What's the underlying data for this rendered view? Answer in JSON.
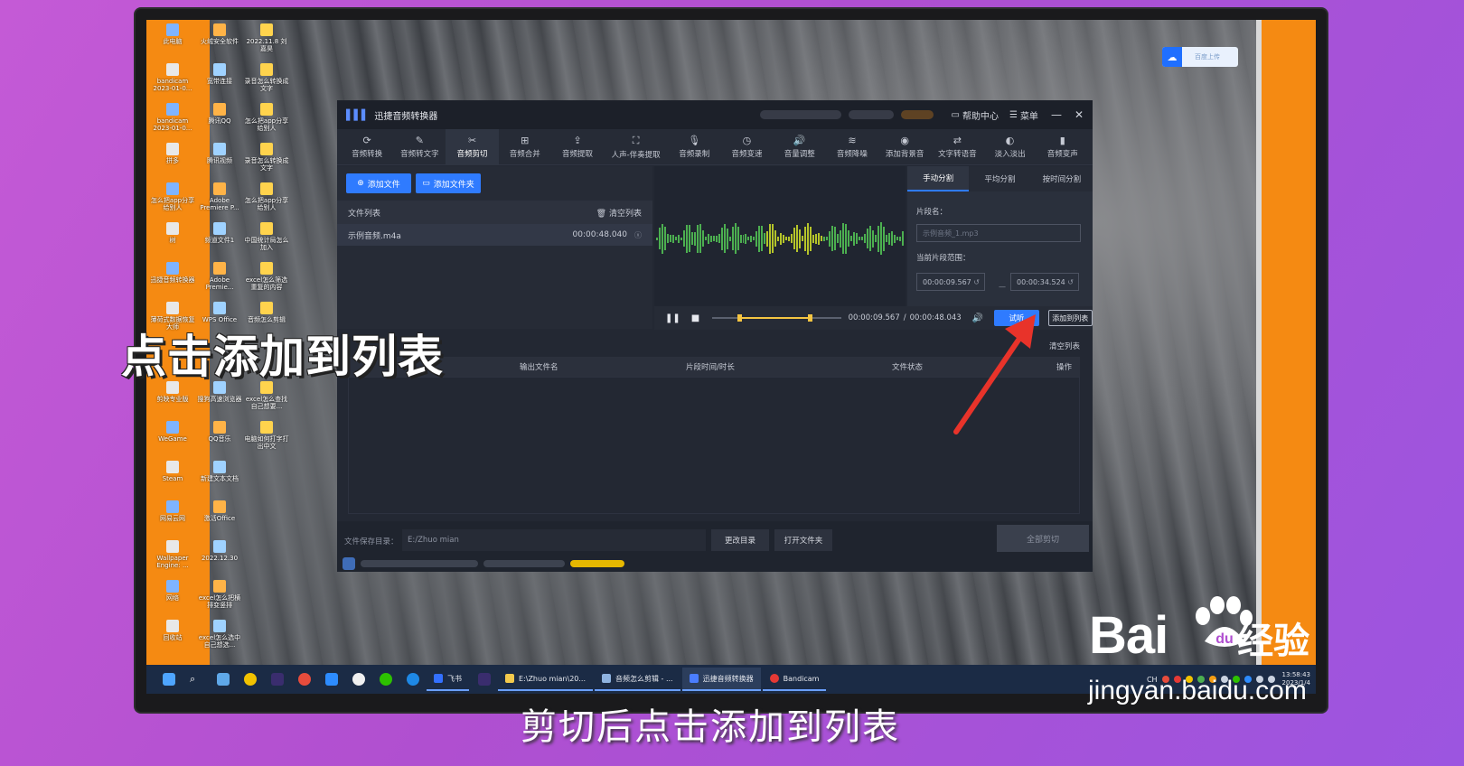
{
  "desktop": {
    "icons": [
      "此电脑",
      "火绒安全软件",
      "2022.11.8 刘嘉昊",
      "bandicam 2023-01-0...",
      "宽带连接",
      "录音怎么转换成文字",
      "bandicam 2023-01-0...",
      "腾讯QQ",
      "怎么把app分享给别人",
      "拼多",
      "腾讯视频",
      "录音怎么转换成文字",
      "怎么把app分享给别人",
      "Adobe Premiere P...",
      "怎么把app分享给别人",
      "树",
      "频道文件1",
      "中国统计局怎么加入",
      "迅捷音频转换器",
      "Adobe Premie...",
      "excel怎么筛选重复的内容",
      "薄荷式数据恢复大师",
      "WPS Office",
      "音频怎么剪辑",
      "",
      "",
      "",
      "剪映专业版",
      "搜狗高速浏览器",
      "excel怎么查找自己想要...",
      "WeGame",
      "QQ音乐",
      "电脑如何打字打出中文",
      "Steam",
      "新建文本文档",
      "",
      "网易云网",
      "激活Office",
      "",
      "Wallpaper Engine: ...",
      "2022.12.30",
      "",
      "网络",
      "excel怎么把横排变竖排",
      "",
      "回收站",
      "excel怎么选中自己想选...",
      ""
    ],
    "cloud_upload_label": "百度上传"
  },
  "app": {
    "title": "迅捷音频转换器",
    "help_label": "帮助中心",
    "menu_label": "菜单",
    "minimize_glyph": "—",
    "close_glyph": "✕",
    "tools": [
      {
        "icon": "⟳",
        "label": "音频转换"
      },
      {
        "icon": "✎",
        "label": "音频转文字"
      },
      {
        "icon": "✂",
        "label": "音频剪切"
      },
      {
        "icon": "⊞",
        "label": "音频合并"
      },
      {
        "icon": "⇪",
        "label": "音频提取"
      },
      {
        "icon": "⛶",
        "label": "人声-伴奏提取"
      },
      {
        "icon": "🎙",
        "label": "音频录制"
      },
      {
        "icon": "◷",
        "label": "音频变速"
      },
      {
        "icon": "🔊",
        "label": "音量调整"
      },
      {
        "icon": "≋",
        "label": "音频降噪"
      },
      {
        "icon": "◉",
        "label": "添加背景音"
      },
      {
        "icon": "⇄",
        "label": "文字转语音"
      },
      {
        "icon": "◐",
        "label": "淡入淡出"
      },
      {
        "icon": "▮",
        "label": "音频变声"
      }
    ],
    "add_file_label": "添加文件",
    "add_folder_label": "添加文件夹",
    "file_list_header": "文件列表",
    "clear_list_label": "清空列表",
    "files": [
      {
        "name": "示例音频.m4a",
        "duration": "00:00:48.040"
      }
    ],
    "split_tabs": [
      "手动分割",
      "平均分割",
      "按时间分割"
    ],
    "segment_name_label": "片段名：",
    "segment_name_placeholder": "示例音频_1.mp3",
    "range_label": "当前片段范围：",
    "range_start": "00:00:09.567",
    "range_end": "00:00:34.524",
    "range_sep": "—",
    "playback": {
      "current": "00:00:09.567",
      "separator": "/",
      "total": "00:00:48.043",
      "selection_start_fraction": 0.199,
      "selection_end_fraction": 0.718
    },
    "preview_label": "试听",
    "add_to_list_label": "添加到列表",
    "output_clear_label": "清空列表",
    "output_columns": [
      "名",
      "输出文件名",
      "片段时间/时长",
      "文件状态",
      "操作"
    ],
    "save_dir_label": "文件保存目录：",
    "save_dir_value": "E:/Zhuo mian",
    "change_dir_label": "更改目录",
    "open_folder_label": "打开文件夹",
    "cut_all_label": "全部剪切"
  },
  "taskbar": {
    "apps": [
      {
        "label": "飞书"
      },
      {
        "label": "E:\\Zhuo mian\\20..."
      },
      {
        "label": "音频怎么剪辑 - ..."
      },
      {
        "label": "迅捷音频转换器"
      },
      {
        "label": "Bandicam"
      }
    ],
    "ime": "CH",
    "time": "13:58:43",
    "date": "2023/1/4"
  },
  "overlay": {
    "caption_left": "点击添加到列表",
    "caption_bottom": "剪切后点击添加到列表",
    "watermark_logo": "Bai",
    "watermark_logo_tail": "经验",
    "watermark_url": "jingyan.baidu.com"
  },
  "colors": {
    "accent_blue": "#2f7bff",
    "waveform_green": "#4caf50",
    "selection_yellow": "#f5c542",
    "desktop_orange": "#f58a12",
    "annotation_red": "#e8332a"
  }
}
